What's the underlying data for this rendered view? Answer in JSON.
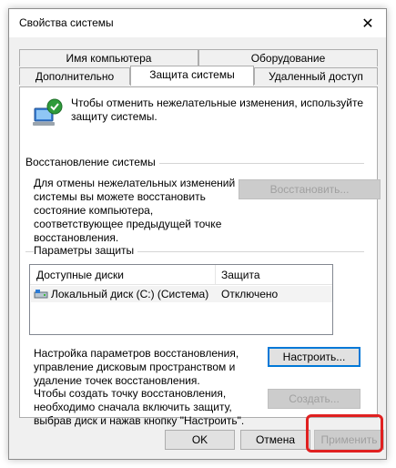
{
  "window": {
    "title": "Свойства системы",
    "close_glyph": "✕"
  },
  "tabs": {
    "row1": [
      "Имя компьютера",
      "Оборудование"
    ],
    "row2": [
      "Дополнительно",
      "Защита системы",
      "Удаленный доступ"
    ]
  },
  "intro_lines": [
    "Чтобы отменить нежелательные изменения, используйте",
    "защиту системы."
  ],
  "restore": {
    "group_title": "Восстановление системы",
    "text_lines": [
      "Для отмены нежелательных изменений",
      "системы вы можете восстановить",
      "состояние компьютера,",
      "соответствующее предыдущей точке",
      "восстановления."
    ],
    "button": "Восстановить..."
  },
  "protection": {
    "group_title": "Параметры защиты",
    "columns": [
      "Доступные диски",
      "Защита"
    ],
    "rows": [
      {
        "drive": "Локальный диск (C:) (Система)",
        "status": "Отключено"
      }
    ],
    "configure_lines": [
      "Настройка параметров восстановления,",
      "управление дисковым пространством и",
      "удаление точек восстановления."
    ],
    "configure_button": "Настроить...",
    "create_lines": [
      "Чтобы создать точку восстановления,",
      "необходимо сначала включить защиту,",
      "выбрав диск и нажав кнопку \"Настроить\"."
    ],
    "create_button": "Создать..."
  },
  "footer": {
    "ok": "OK",
    "cancel": "Отмена",
    "apply": "Применить"
  },
  "colors": {
    "highlight": "#e02020",
    "focus": "#0078d7"
  }
}
